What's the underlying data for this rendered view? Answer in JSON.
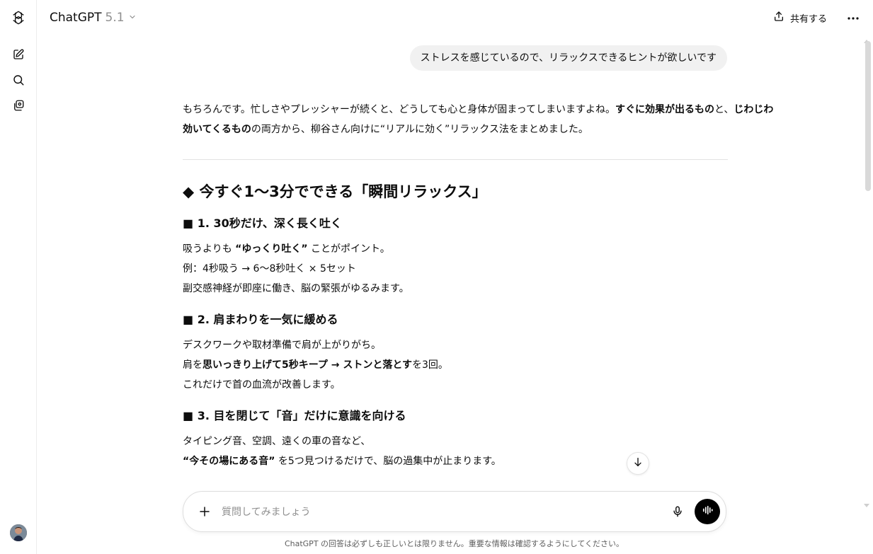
{
  "header": {
    "model_name": "ChatGPT",
    "model_version": "5.1",
    "share_label": "共有する"
  },
  "conversation": {
    "user_message": "ストレスを感じているので、リラックスできるヒントが欲しいです",
    "intro": {
      "l1_a": "もちろんです。忙しさやプレッシャーが続くと、どうしても心と身体が固まってしまいますよね。",
      "l1_b": "すぐに効果が出るもの",
      "l1_c": "と、",
      "l1_d": "じわじわ",
      "l2_a": "効いてくるもの",
      "l2_b": "の両方から、柳谷さん向けに“リアルに効く”リラックス法をまとめました。"
    },
    "heading": "◆ 今すぐ1〜3分でできる「瞬間リラックス」",
    "sections": [
      {
        "title": "■ 1. 30秒だけ、深く長く吐く",
        "l1_a": "吸うよりも ",
        "l1_b": "“ゆっくり吐く”",
        "l1_c": " ことがポイント。",
        "l2": "例：4秒吸う → 6〜8秒吐く × 5セット",
        "l3": "副交感神経が即座に働き、脳の緊張がゆるみます。"
      },
      {
        "title": "■ 2. 肩まわりを一気に緩める",
        "l1": "デスクワークや取材準備で肩が上がりがち。",
        "l2_a": "肩を",
        "l2_b": "思いっきり上げて5秒キープ → ストンと落とす",
        "l2_c": "を3回。",
        "l3": "これだけで首の血流が改善します。"
      },
      {
        "title": "■ 3. 目を閉じて「音」だけに意識を向ける",
        "l1": "タイピング音、空調、遠くの車の音など、",
        "l2_a": "“今その場にある音”",
        "l2_b": " を5つ見つけるだけで、脳の過集中が止まります。"
      }
    ]
  },
  "composer": {
    "placeholder": "質問してみましょう"
  },
  "footer": {
    "disclaimer": "ChatGPT の回答は必ずしも正しいとは限りません。重要な情報は確認するようにしてください。"
  },
  "icons": {
    "logo": "openai-logo-icon",
    "new_chat": "new-chat-icon",
    "search": "search-icon",
    "library": "library-icon",
    "share": "share-icon",
    "more": "more-icon",
    "scroll_down": "arrow-down-icon",
    "plus": "plus-icon",
    "mic": "mic-icon",
    "voice": "voice-mode-icon"
  },
  "colors": {
    "user_bubble": "#f1f1f1",
    "voice_button": "#000000",
    "muted_text": "#8f8f8f"
  }
}
